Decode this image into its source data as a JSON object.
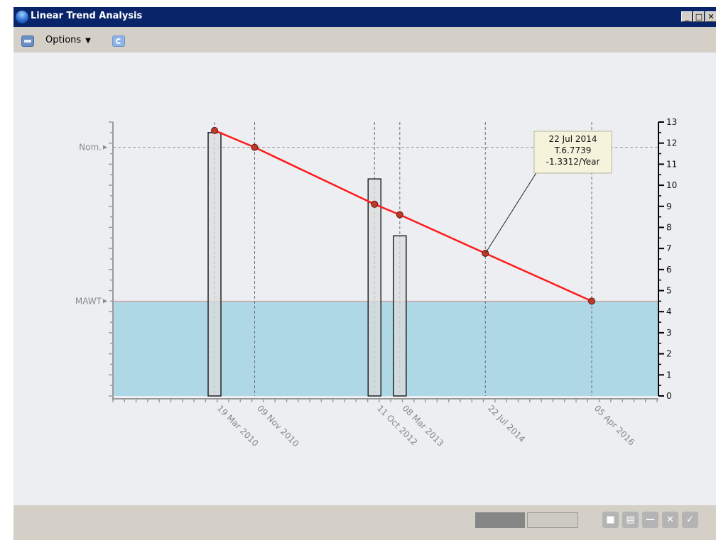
{
  "window": {
    "title": "Linear Trend Analysis",
    "controls": {
      "minimize": "_",
      "maximize": "□",
      "close": "✕"
    }
  },
  "toolbar": {
    "print_icon": "print-icon",
    "options_label": "Options",
    "options_caret": "▼",
    "refresh_icon": "refresh-icon"
  },
  "chart_data": {
    "type": "bar",
    "x_axis": {
      "kind": "date",
      "min": "2008-08-01",
      "max": "2017-05-01",
      "tick_label_color": "#888888"
    },
    "y_axis": {
      "min": 0,
      "max": 13,
      "side": "right",
      "ticks": [
        "0",
        "1",
        "2",
        "3",
        "4",
        "5",
        "6",
        "7",
        "8",
        "9",
        "10",
        "11",
        "12",
        "13"
      ]
    },
    "categories": [
      "19 Mar 2010",
      "09 Nov 2010",
      "11 Oct 2012",
      "08 Mar 2013",
      "22 Jul 2014",
      "05 Apr 2016"
    ],
    "dates": [
      "2010-03-19",
      "2010-11-09",
      "2012-10-11",
      "2013-03-08",
      "2014-07-22",
      "2016-04-05"
    ],
    "bars": [
      {
        "date": "2010-03-19",
        "value": 12.5
      },
      {
        "date": "2012-10-11",
        "value": 10.3
      },
      {
        "date": "2013-03-08",
        "value": 7.6
      }
    ],
    "series": [
      {
        "type": "line",
        "color": "#ff1a1a",
        "values": [
          12.6,
          11.8,
          9.1,
          8.6,
          6.77,
          4.5
        ]
      }
    ],
    "reference_lines": [
      {
        "label": "Nom.",
        "value": 11.8,
        "style": "dashed"
      },
      {
        "label": "MAWT",
        "value": 4.5,
        "style": "fill-below",
        "fill": "#aed8e6"
      }
    ],
    "annotation": {
      "date": "2014-07-22",
      "value": 6.77,
      "lines": [
        "22 Jul 2014",
        "T.6.7739",
        "-1.3312/Year"
      ]
    },
    "grid": "vertical dashed at data dates"
  },
  "statusbar": {
    "progress_fraction": 0.5,
    "button_icons": [
      "stop-icon",
      "save-icon",
      "minus-icon",
      "close-icon",
      "check-icon"
    ],
    "button_glyphs": [
      "■",
      "▤",
      "—",
      "✕",
      "✓"
    ]
  },
  "colors": {
    "titlebar": "#0a246a",
    "chart_bg": "#eceef2",
    "line": "#ff1a1a",
    "mawt_fill": "#aed8e6",
    "chrome": "#d4d0c8"
  }
}
